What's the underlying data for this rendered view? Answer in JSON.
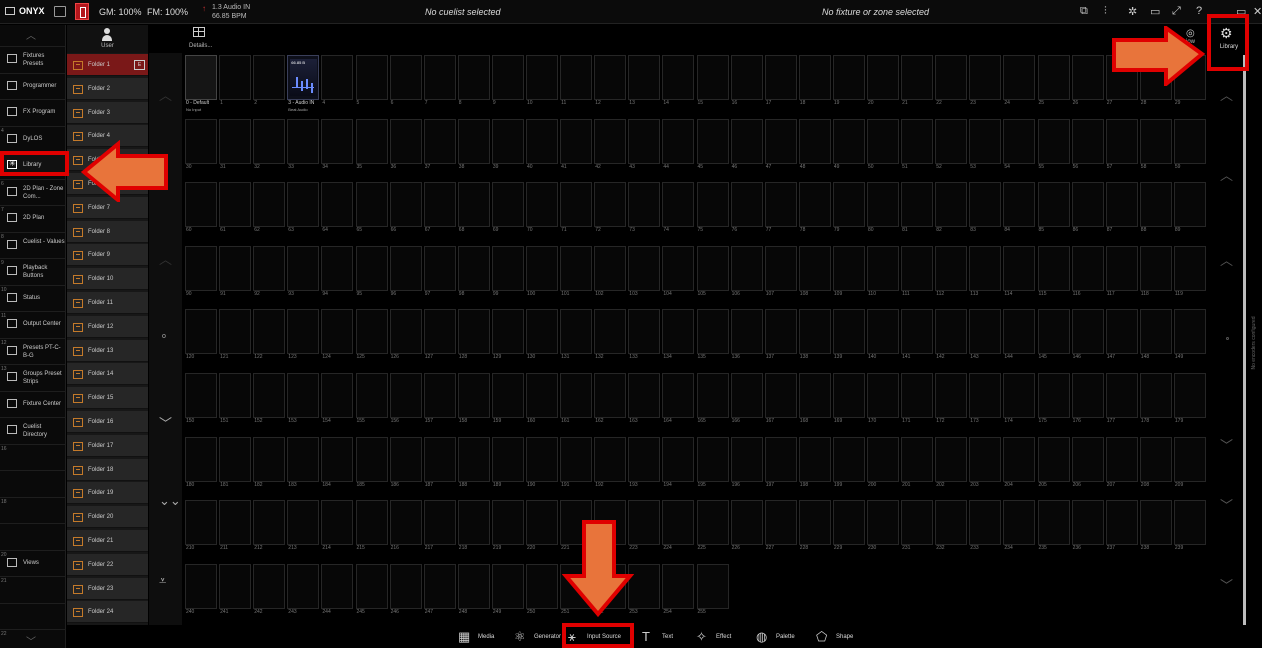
{
  "topbar": {
    "app_name": "ONYX",
    "gm": "GM: 100%",
    "fm": "FM: 100%",
    "audio_line1": "1.3 Audio IN",
    "audio_line2": "66.85 BPM",
    "cuelist_status": "No cuelist selected",
    "fixture_status": "No fixture or zone selected"
  },
  "sidebar": {
    "items": [
      {
        "num": "",
        "label": "Fixtures Presets"
      },
      {
        "num": "",
        "label": "Programmer"
      },
      {
        "num": "",
        "label": "FX Program"
      },
      {
        "num": "4",
        "label": "DyLOS"
      },
      {
        "num": "",
        "label": "Library"
      },
      {
        "num": "6",
        "label": "2D Plan - Zone Com..."
      },
      {
        "num": "7",
        "label": "2D Plan"
      },
      {
        "num": "8",
        "label": "Cuelist - Values"
      },
      {
        "num": "9",
        "label": "Playback Buttons"
      },
      {
        "num": "10",
        "label": "Status"
      },
      {
        "num": "11",
        "label": "Output Center"
      },
      {
        "num": "12",
        "label": "Presets PT-C-B-G"
      },
      {
        "num": "13",
        "label": "Groups Preset Strips"
      },
      {
        "num": "",
        "label": "Fixture Center"
      },
      {
        "num": "",
        "label": "Cuelist Directory"
      },
      {
        "num": "16",
        "label": ""
      },
      {
        "num": "",
        "label": ""
      },
      {
        "num": "18",
        "label": ""
      },
      {
        "num": "",
        "label": ""
      },
      {
        "num": "20",
        "label": "Views"
      },
      {
        "num": "21",
        "label": ""
      },
      {
        "num": "",
        "label": ""
      },
      {
        "num": "22",
        "label": ""
      }
    ]
  },
  "folders": {
    "header": "User",
    "items": [
      "Folder 1",
      "Folder 2",
      "Folder 3",
      "Folder 4",
      "Folder 5",
      "Folder 6",
      "Folder 7",
      "Folder 8",
      "Folder 9",
      "Folder 10",
      "Folder 11",
      "Folder 12",
      "Folder 13",
      "Folder 14",
      "Folder 15",
      "Folder 16",
      "Folder 17",
      "Folder 18",
      "Folder 19",
      "Folder 20",
      "Folder 21",
      "Folder 22",
      "Folder 23",
      "Folder 24"
    ],
    "edit_label": "E"
  },
  "details_label": "Details...",
  "grid": {
    "cell0_label": "0 - Default",
    "cell0_sub": "No Input",
    "cell3_label": "3 - Audio IN",
    "cell3_sub": "Beat Audio",
    "cell3_bpm": "66.85 B",
    "total_cells": 256
  },
  "right": {
    "view_label": "iow",
    "library_label": "Library",
    "no_encoders": "No encoders configured"
  },
  "toolbar": {
    "items": [
      {
        "label": "Media",
        "icon": "media-icon"
      },
      {
        "label": "Generator",
        "icon": "generator-icon"
      },
      {
        "label": "Input Source",
        "icon": "input-source-icon"
      },
      {
        "label": "Text",
        "icon": "text-icon"
      },
      {
        "label": "Effect",
        "icon": "effect-icon"
      },
      {
        "label": "Palette",
        "icon": "palette-icon"
      },
      {
        "label": "Shape",
        "icon": "shape-icon"
      }
    ]
  },
  "colors": {
    "highlight": "#e00000",
    "arrow": "#e8743b",
    "folder_selected": "#7a1818",
    "folder_icon": "#c47a2a"
  }
}
